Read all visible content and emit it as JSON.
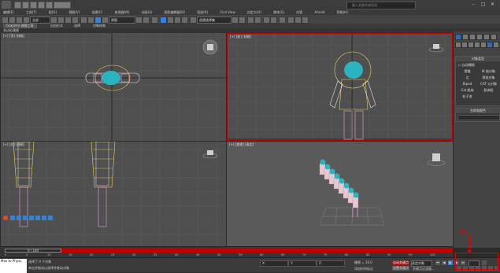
{
  "window": {
    "search_placeholder": "键入关键字或短语",
    "min": "–",
    "max": "□",
    "close": "✕"
  },
  "menu": [
    "编辑(E)",
    "工具(T)",
    "组(G)",
    "视图(V)",
    "创建(C)",
    "修改器(M)",
    "动画(A)",
    "图形编辑器(D)",
    "渲染(R)",
    "Civil View",
    "自定义(U)",
    "脚本(S)",
    "内容",
    "Arnold",
    "帮助(H)"
  ],
  "toolbar": {
    "undo_dropdown": "全部",
    "ref_dropdown": "视图",
    "selection_dropdown": "创建选择集"
  },
  "ribbon": {
    "tabs": [
      "Graphite 建模工具",
      "自由形式",
      "选择",
      "对象绘制"
    ],
    "subtitle": "多边形建模"
  },
  "viewports": {
    "top": "[+] [顶] [线框]",
    "front": "[+] [前] [线框]",
    "left": "[+] [左] [线框]",
    "perspective": "[+] [透视] [真实]"
  },
  "command_panel": {
    "section1_title": "对象类型",
    "autogrid": "自动栅格",
    "buttons": [
      [
        "骨骼",
        "IK 链对象"
      ],
      [
        "点",
        "群组对象"
      ],
      [
        "Biped",
        "CAT 父对象"
      ],
      [
        "Cat 肌肉",
        "肌肉股"
      ]
    ],
    "extra": "粒子流",
    "section2_title": "名称和颜色"
  },
  "timeline": {
    "slider": "0 / 100",
    "ticks": [
      "0",
      "5",
      "10",
      "15",
      "20",
      "25",
      "30",
      "35",
      "40",
      "45",
      "50",
      "55",
      "60",
      "65",
      "70",
      "75",
      "80",
      "85",
      "90",
      "95",
      "100"
    ]
  },
  "status": {
    "maxscript": "Max to Physc.",
    "line1": "选择了 0 个对象",
    "line2": "单击并拖动以选择并移动对象",
    "x_label": "X:",
    "y_label": "Y:",
    "z_label": "Z:",
    "grid": "栅格 = 10.0",
    "add_time_tag": "添加时间标记",
    "autokey": "自动关键点",
    "setkey": "设置关键点",
    "keysel": "选定对象",
    "keyfilter": "关键点过滤器..."
  },
  "annotation": {
    "label": "播放"
  },
  "colors": {
    "timeline_track": "#c00000",
    "annotation": "#e00000",
    "active_viewport_border": "#b30000",
    "character_teal": "#2bb3c0"
  }
}
